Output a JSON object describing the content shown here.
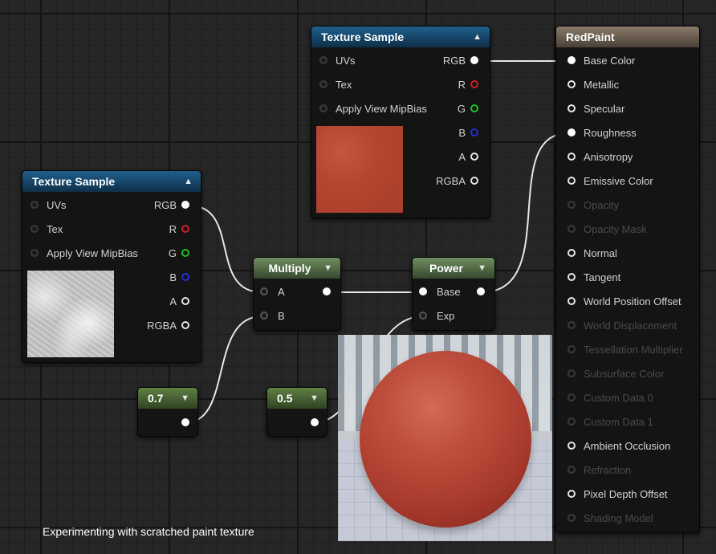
{
  "texture_sample_top": {
    "title": "Texture Sample",
    "inputs": [
      "UVs",
      "Tex",
      "Apply View MipBias"
    ],
    "outputs": [
      "RGB",
      "R",
      "G",
      "B",
      "A",
      "RGBA"
    ]
  },
  "texture_sample_left": {
    "title": "Texture Sample",
    "inputs": [
      "UVs",
      "Tex",
      "Apply View MipBias"
    ],
    "outputs": [
      "RGB",
      "R",
      "G",
      "B",
      "A",
      "RGBA"
    ]
  },
  "multiply": {
    "title": "Multiply",
    "inputs": [
      "A",
      "B"
    ]
  },
  "power": {
    "title": "Power",
    "inputs": [
      "Base",
      "Exp"
    ]
  },
  "const_a": {
    "value": "0.7"
  },
  "const_b": {
    "value": "0.5"
  },
  "result": {
    "title": "RedPaint",
    "pins": [
      {
        "label": "Base Color"
      },
      {
        "label": "Metallic"
      },
      {
        "label": "Specular"
      },
      {
        "label": "Roughness"
      },
      {
        "label": "Anisotropy"
      },
      {
        "label": "Emissive Color"
      },
      {
        "label": "Opacity"
      },
      {
        "label": "Opacity Mask"
      },
      {
        "label": "Normal"
      },
      {
        "label": "Tangent"
      },
      {
        "label": "World Position Offset"
      },
      {
        "label": "World Displacement"
      },
      {
        "label": "Tessellation Multiplier"
      },
      {
        "label": "Subsurface Color"
      },
      {
        "label": "Custom Data 0"
      },
      {
        "label": "Custom Data 1"
      },
      {
        "label": "Ambient Occlusion"
      },
      {
        "label": "Refraction"
      },
      {
        "label": "Pixel Depth Offset"
      },
      {
        "label": "Shading Model"
      }
    ]
  },
  "caption": "Experimenting with scratched paint texture",
  "colors": {
    "texture_header": "#1f5f8e",
    "math_header": "#6f8f5f",
    "result_header": "#8a7b6a",
    "paint_red": "#b5452f"
  },
  "icons": {
    "collapse": "triangle-up-icon",
    "expand": "triangle-down-icon"
  }
}
